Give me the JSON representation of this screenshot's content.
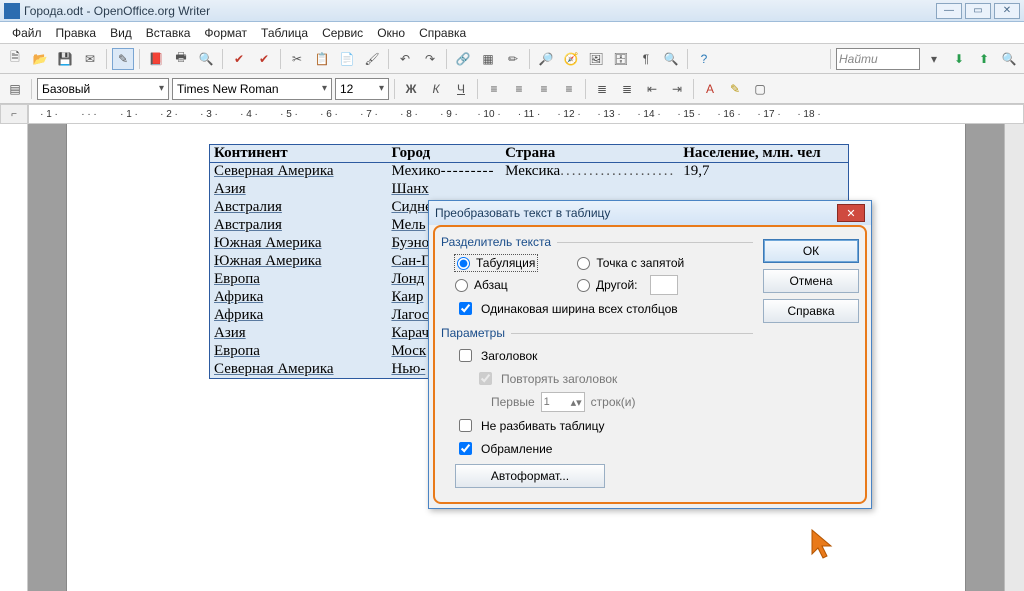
{
  "window": {
    "title": "Города.odt - OpenOffice.org Writer"
  },
  "menu": {
    "items": [
      "Файл",
      "Правка",
      "Вид",
      "Вставка",
      "Формат",
      "Таблица",
      "Сервис",
      "Окно",
      "Справка"
    ]
  },
  "formatbar": {
    "style": "Базовый",
    "font": "Times New Roman",
    "size": "12"
  },
  "findbar": {
    "placeholder": "Найти"
  },
  "ruler": {
    "marks": [
      "· · 1 ·",
      "· · · ·",
      "· 1 ·",
      "· 2 ·",
      "· 3 ·",
      "· 4 ·",
      "· 5 ·",
      "· 6 ·",
      "· 7 ·",
      "· 8 ·",
      "· 9 ·",
      "· 10 ·",
      "· 11 ·",
      "· 12 ·",
      "· 13 ·",
      "· 14 ·",
      "· 15 ·",
      "· 16 ·",
      "· 17 ·",
      "· 18 ·"
    ]
  },
  "table": {
    "headers": [
      "Континент",
      "Город",
      "Страна",
      "Население, млн. чел"
    ],
    "rows": [
      [
        "Северная Америка",
        "Мехико",
        "Мексика",
        "19,7"
      ],
      [
        "Азия",
        "Шанх",
        "",
        " "
      ],
      [
        "Австралия",
        "Сидне",
        "",
        " "
      ],
      [
        "Австралия",
        "Мель",
        "",
        " "
      ],
      [
        "Южная Америка",
        "Буэно",
        "",
        " "
      ],
      [
        "Южная Америка",
        "Сан-П",
        "",
        " "
      ],
      [
        "Европа",
        "Лонд",
        "",
        " "
      ],
      [
        "Африка",
        "Каир",
        "",
        " "
      ],
      [
        "Африка",
        "Лагос",
        "",
        " "
      ],
      [
        "Азия",
        "Карач",
        "",
        " "
      ],
      [
        "Европа",
        "Моск",
        "",
        " "
      ],
      [
        "Северная Америка",
        "Нью-",
        "",
        " "
      ]
    ]
  },
  "dialog": {
    "title": "Преобразовать текст в таблицу",
    "ok": "ОК",
    "cancel": "Отмена",
    "help": "Справка",
    "fieldset1": "Разделитель текста",
    "opt_tab": "Табуляция",
    "opt_semi": "Точка с запятой",
    "opt_para": "Абзац",
    "opt_other": "Другой:",
    "chk_equal": "Одинаковая ширина всех столбцов",
    "fieldset2": "Параметры",
    "chk_heading": "Заголовок",
    "chk_repeat": "Повторять заголовок",
    "first_label": "Первые",
    "first_value": "1",
    "first_rows": "строк(и)",
    "chk_nosplit": "Не разбивать таблицу",
    "chk_border": "Обрамление",
    "autoformat": "Автоформат..."
  }
}
